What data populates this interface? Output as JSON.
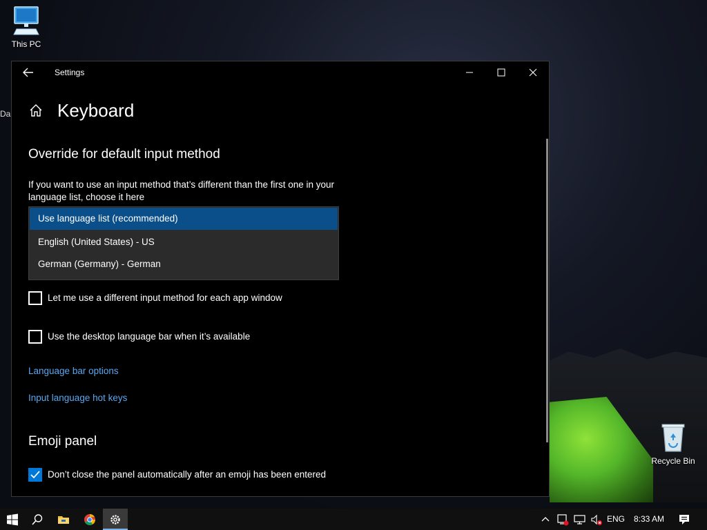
{
  "desktop": {
    "this_pc_label": "This PC",
    "partial_label": "Da",
    "recycle_bin_label": "Recycle Bin"
  },
  "window": {
    "title": "Settings",
    "page_title": "Keyboard"
  },
  "override_section": {
    "title": "Override for default input method",
    "description": "If you want to use an input method that’s different than the first one in your language list, choose it here",
    "options": [
      "Use language list (recommended)",
      "English (United States) - US",
      "German (Germany) - German"
    ],
    "selected_index": 0
  },
  "checkboxes": {
    "per_app_window": {
      "label": "Let me use a different input method for each app window",
      "checked": false
    },
    "desktop_language_bar": {
      "label": "Use the desktop language bar when it’s available",
      "checked": false
    }
  },
  "links": {
    "language_bar_options": "Language bar options",
    "input_language_hot_keys": "Input language hot keys"
  },
  "emoji_section": {
    "title": "Emoji panel",
    "checkbox": {
      "label": "Don’t close the panel automatically after an emoji has been entered",
      "checked": true
    }
  },
  "taskbar": {
    "language": "ENG",
    "time": "8:33 AM"
  },
  "colors": {
    "accent": "#0078d7",
    "selection": "#0b4f8a",
    "link": "#5aa8f0"
  }
}
